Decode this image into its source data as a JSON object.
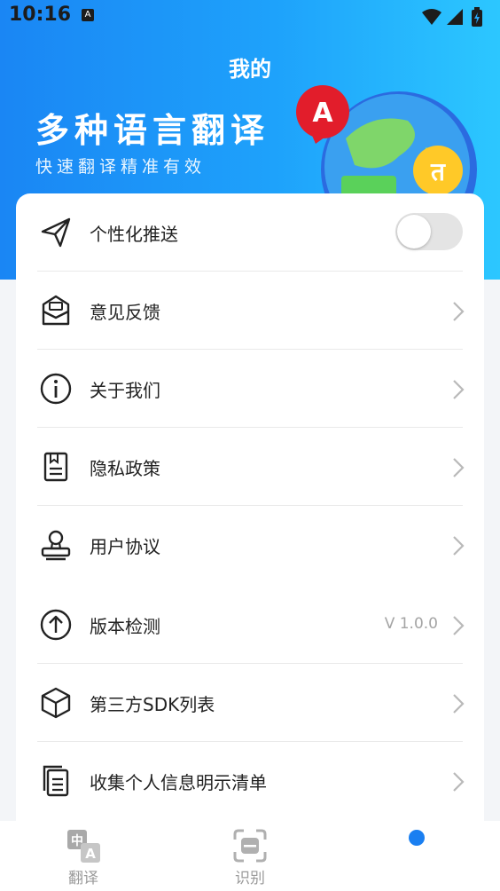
{
  "status_bar": {
    "time": "10:16",
    "notification_glyph": "A"
  },
  "header": {
    "title": "我的",
    "slogan": "多种语言翻译",
    "subslogan": "快速翻译精准有效",
    "badge_a": "A",
    "badge_b": "त"
  },
  "settings": {
    "push": {
      "label": "个性化推送",
      "enabled": false
    },
    "items": [
      {
        "label": "意见反馈",
        "icon": "feedback-icon"
      },
      {
        "label": "关于我们",
        "icon": "info-icon"
      },
      {
        "label": "隐私政策",
        "icon": "document-icon"
      },
      {
        "label": "用户协议",
        "icon": "user-stamp-icon"
      },
      {
        "label": "版本检测",
        "icon": "upload-arrow-icon",
        "value": "V 1.0.0"
      },
      {
        "label": "第三方SDK列表",
        "icon": "cube-icon"
      },
      {
        "label": "收集个人信息明示清单",
        "icon": "clipboard-list-icon"
      }
    ]
  },
  "tabbar": {
    "tabs": [
      {
        "label": "翻译",
        "icon": "translate-icon",
        "glyph_zh": "中",
        "glyph_a": "A"
      },
      {
        "label": "识别",
        "icon": "scan-icon"
      },
      {
        "label": "",
        "icon": "mine-dot-icon",
        "active": true
      }
    ]
  },
  "colors": {
    "accent": "#1a7ff1",
    "hero_start": "#1a86f4",
    "hero_end": "#2cc7ff"
  }
}
